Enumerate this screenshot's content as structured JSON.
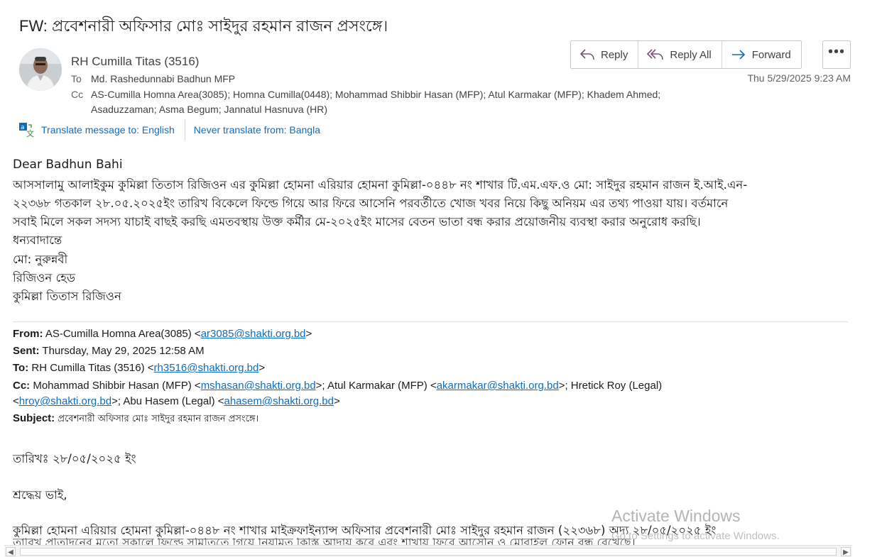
{
  "message": {
    "subject": "FW: প্রবেশনারী অফিসার মোঃ সাইদুর রহমান রাজন প্রসংঙ্গে।",
    "sender": "RH Cumilla Titas (3516)",
    "to_label": "To",
    "to": "Md. Rashedunnabi Badhun MFP",
    "cc_label": "Cc",
    "cc_line1": "AS-Cumilla Homna Area(3085); Homna Cumilla(0448); Mohammad Shibbir Hasan (MFP); Atul  Karmakar (MFP); Khadem Ahmed;",
    "cc_line2": "Asaduzzaman; Asma Begum; Jannatul Hasnuva (HR)",
    "date": "Thu 5/29/2025 9:23 AM"
  },
  "actions": {
    "reply": "Reply",
    "reply_all": "Reply All",
    "forward": "Forward",
    "more": "•••"
  },
  "translate": {
    "translate_to": "Translate message to: English",
    "never_translate": "Never translate from: Bangla"
  },
  "body": {
    "greeting": "Dear  Badhun  Bahi",
    "line1": "আসসালামু আলাইকুম কুমিল্লা তিতাস রিজিওন এর কুমিল্লা হোমনা এরিয়ার হোমনা কুমিল্লা-০৪৪৮ নং শাখার টি.এম.এফ.ও মো: সাইদুর রহমান রাজন ই.আই.এন-",
    "line2": "২২৩৬৮ গতকাল ২৮.০৫.২০২৫ইং তারিখ বিকেলে ফিল্ডে গিয়ে আর ফিরে আসেনি পরবর্তীতে খোজ খবর নিয়ে কিছু অনিয়ম এর তথ্য পাওয়া যায়। বর্তমানে",
    "line3": "সবাই মিলে সকল সদস্য যাচাই বাছই করছি এমতবস্থায় উক্ত কর্মীর মে-২০২৫ইং মাসের বেতন ভাতা বন্ধ করার প্রয়োজনীয় ব্যবস্থা করার অনুরোধ করছি।",
    "thanks": "ধন্যবাদান্তে",
    "sig_name": "মো:  নুরুন্নবী",
    "sig_title": "রিজিওন  হেড",
    "sig_region": "কুমিল্লা  তিতাস  রিজিওন"
  },
  "forwarded": {
    "from_label": "From:",
    "from_name": "AS-Cumilla Homna Area(3085) <",
    "from_email": "ar3085@shakti.org.bd",
    "sent_label": "Sent:",
    "sent_value": "Thursday, May 29, 2025 12:58 AM",
    "to_label": "To:",
    "to_name": "RH Cumilla Titas (3516) <",
    "to_email": "rh3516@shakti.org.bd",
    "cc_label": "Cc:",
    "cc_name1": "Mohammad Shibbir Hasan (MFP) <",
    "cc_email1": "mshasan@shakti.org.bd",
    "cc_name2": ">; Atul Karmakar (MFP) <",
    "cc_email2": "akarmakar@shakti.org.bd",
    "cc_name3": ">; Hretick Roy (Legal)",
    "cc_email3": "hroy@shakti.org.bd",
    "cc_name4": ">; Abu Hasem (Legal) <",
    "cc_email4": "ahasem@shakti.org.bd",
    "subject_label": "Subject:",
    "subject_value": "প্রবেশনারী অফিসার মোঃ সাইদুর রহমান রাজন প্রসংঙ্গে।",
    "date_line": "তারিখঃ ২৮/০৫/২০২৫ ইং",
    "salutation": "শ্রদ্ধেয় ভাই,",
    "para1": "কুমিল্লা হোমনা এরিয়ার হোমনা কুমিল্লা-০৪৪৮ নং শাখার মাইক্রফাইন্যান্স অফিসার প্রবেশনারী মোঃ সাইদুর রহমান রাজন (২২৩৬৮) অদ্য ২৮/০৫/২০২৫ ইং",
    "para2": "তারিখ প্রতিদিনের মতো সকালে ফিল্ডে সমিতিতে গিয়ে নিয়মিত কিস্তি আদায় করে এবং শাখায় ফিরে আসেনি ও মোবাইল ফোন বন্ধ রেখেছে।"
  },
  "watermark": {
    "title": "Activate Windows",
    "subtitle": "Go to Settings to activate Windows."
  },
  "scrollbar": {
    "left_arrow": "◀",
    "right_arrow": "▶"
  }
}
